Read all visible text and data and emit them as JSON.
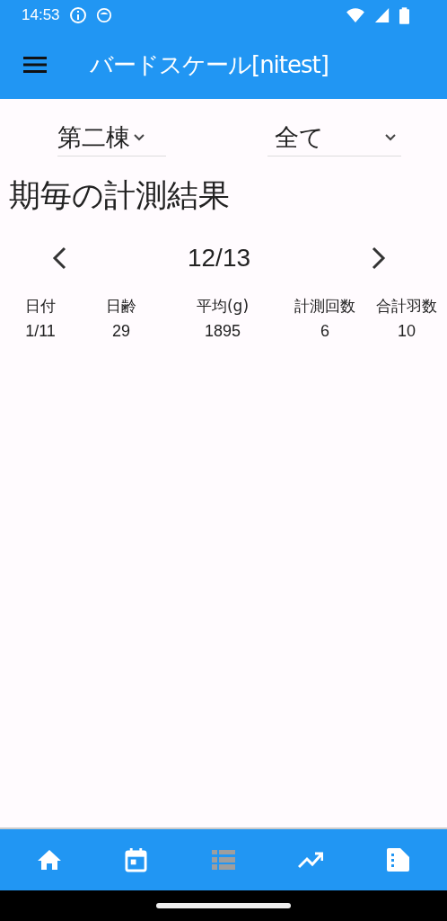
{
  "status_bar": {
    "time": "14:53"
  },
  "app_bar": {
    "title": "バードスケール[nitest]"
  },
  "filters": [
    {
      "value": "第二棟"
    },
    {
      "value": "全て"
    }
  ],
  "section_title": "期毎の計測結果",
  "period_nav": {
    "label": "12/13"
  },
  "table": {
    "columns": [
      "日付",
      "日齢",
      "平均(g)",
      "計測回数",
      "合計羽数"
    ],
    "rows": [
      [
        "1/11",
        "29",
        "1895",
        "6",
        "10"
      ]
    ]
  },
  "bottom_nav": [
    {
      "kind": "home",
      "selected": false
    },
    {
      "kind": "calendar",
      "selected": false
    },
    {
      "kind": "list",
      "selected": true
    },
    {
      "kind": "trend",
      "selected": false
    },
    {
      "kind": "document",
      "selected": false
    }
  ]
}
